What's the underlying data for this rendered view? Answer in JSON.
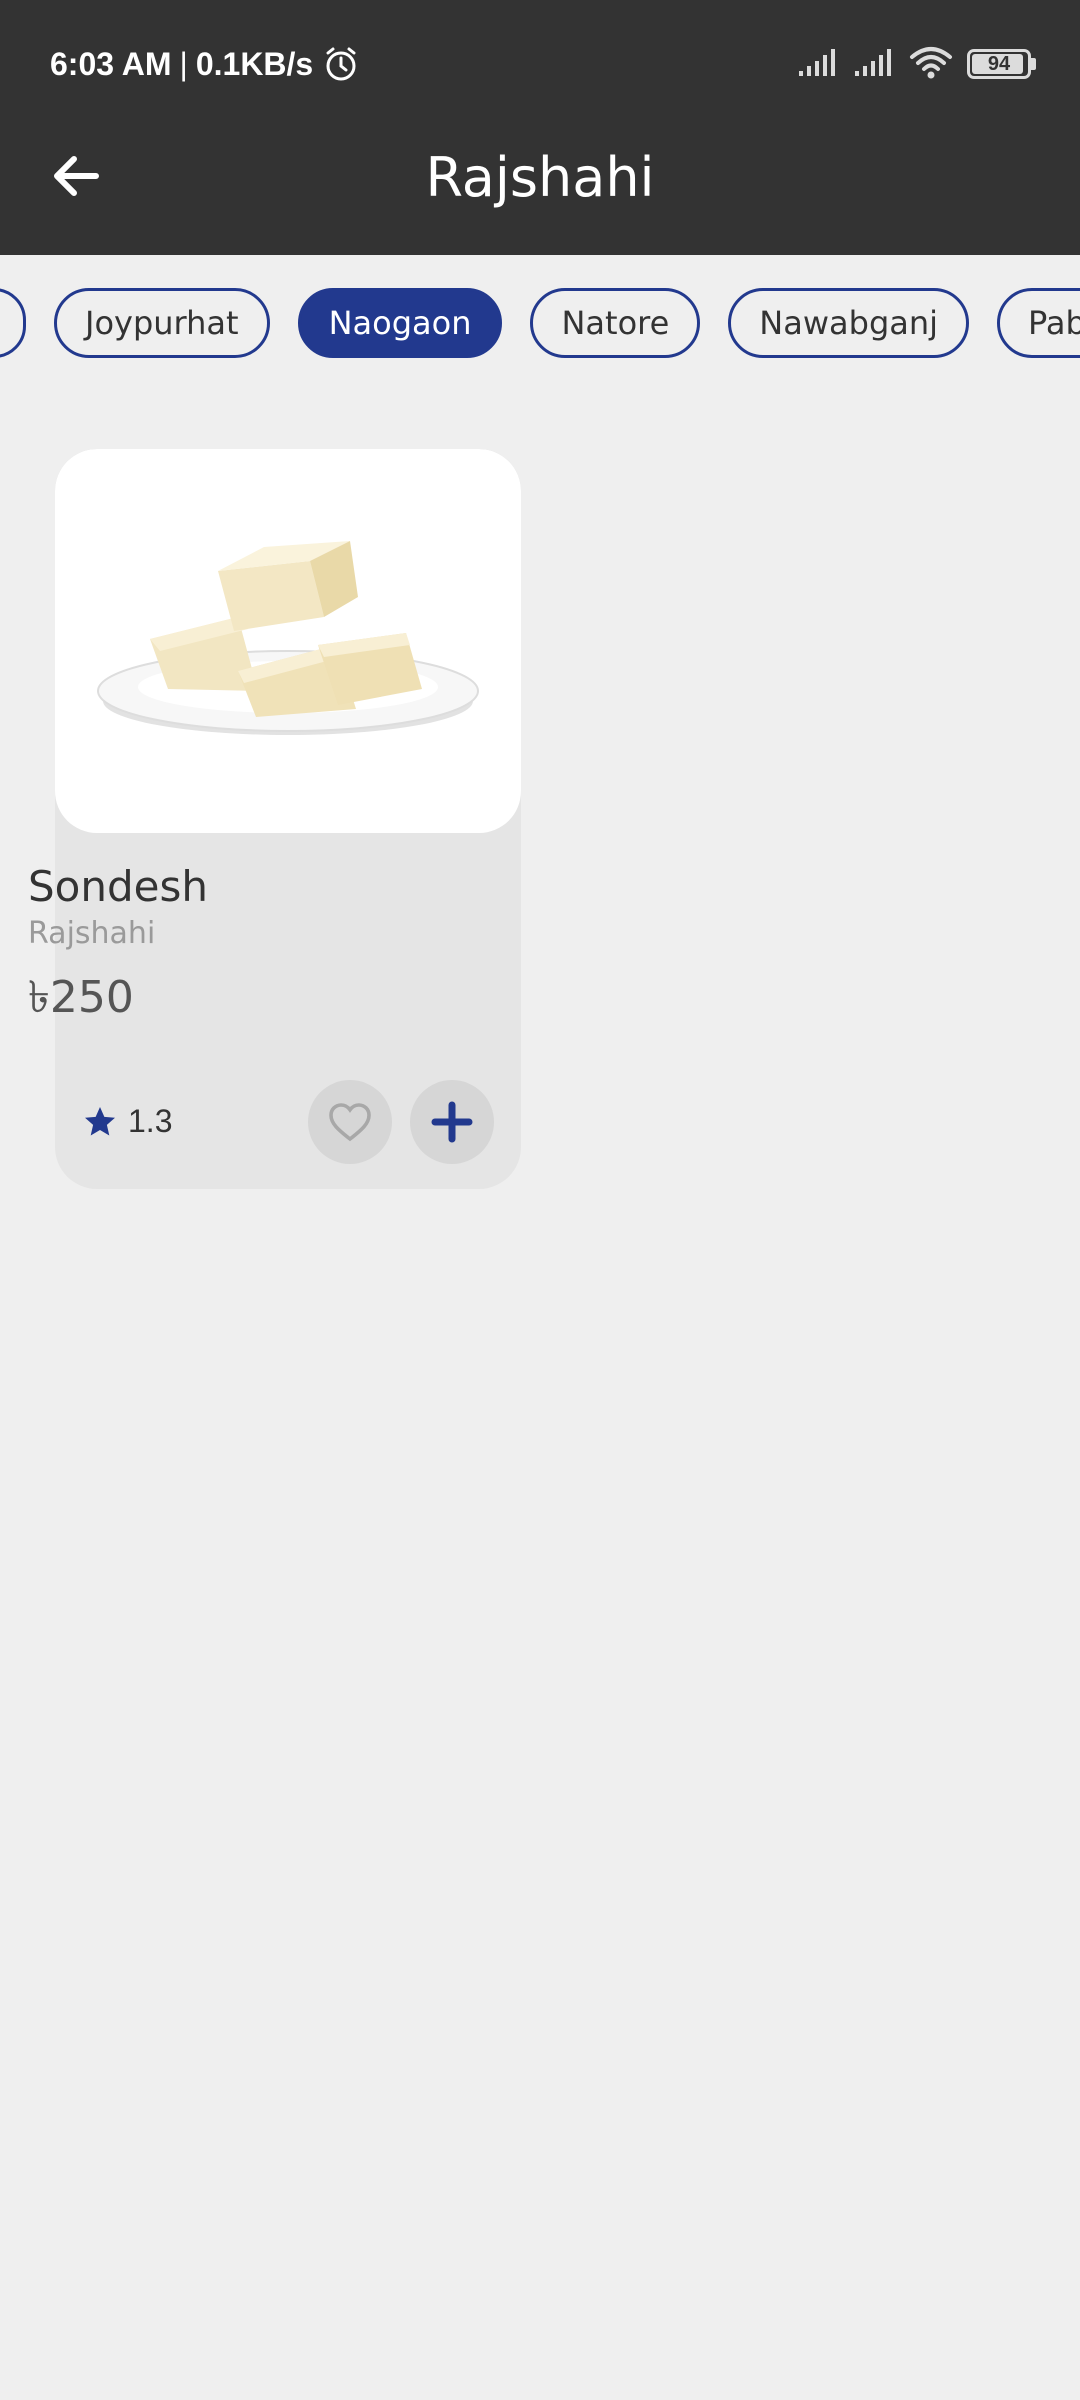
{
  "status_bar": {
    "time": "6:03 AM",
    "separator": "|",
    "speed": "0.1KB/s",
    "battery": "94",
    "battery_fraction": 0.94,
    "icons": [
      "alarm-icon",
      "signal-icon",
      "signal-icon",
      "wifi-icon",
      "battery-icon"
    ]
  },
  "header": {
    "title": "Rajshahi",
    "back_icon": "arrow-left-icon"
  },
  "chips": {
    "items": [
      "Joypurhat",
      "Naogaon",
      "Natore",
      "Nawabganj",
      "Pabna"
    ],
    "selected": "Naogaon"
  },
  "colors": {
    "header_bg": "#333333",
    "page_bg": "#efefef",
    "accent": "#22398e",
    "card_bg": "#e5e5e5"
  },
  "products": [
    {
      "name": "Sondesh",
      "region": "Rajshahi",
      "price": "৳250",
      "rating": "1.3",
      "icons": [
        "star-icon",
        "heart-icon",
        "plus-icon"
      ]
    }
  ]
}
